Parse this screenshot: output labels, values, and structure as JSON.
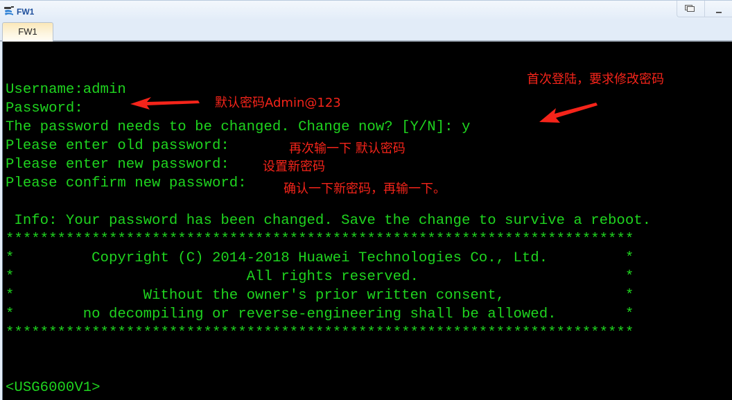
{
  "window": {
    "title": "FW1",
    "app_icon": "network-device-icon",
    "controls": [
      "restore-icon",
      "minimize-icon"
    ]
  },
  "tabs": [
    {
      "label": "FW1",
      "active": true
    }
  ],
  "terminal": {
    "text_color": "#1fd41f",
    "background": "#000000",
    "lines": [
      "Username:admin",
      "Password:",
      "The password needs to be changed. Change now? [Y/N]: y",
      "Please enter old password:",
      "Please enter new password:",
      "Please confirm new password:",
      "",
      " Info: Your password has been changed. Save the change to survive a reboot.",
      "*************************************************************************",
      "*         Copyright (C) 2014-2018 Huawei Technologies Co., Ltd.         *",
      "*                           All rights reserved.                        *",
      "*               Without the owner's prior written consent,              *",
      "*        no decompiling or reverse-engineering shall be allowed.        *",
      "*************************************************************************",
      "",
      "",
      "",
      "<USG6000V1>"
    ]
  },
  "annotations": {
    "color": "#f5241a",
    "first_login": "首次登陆，要求修改密码",
    "default_password": "默认密码Admin@123",
    "reenter_default": "再次输一下 默认密码",
    "set_new": "设置新密码",
    "confirm_new": "确认一下新密码，再输一下。"
  }
}
